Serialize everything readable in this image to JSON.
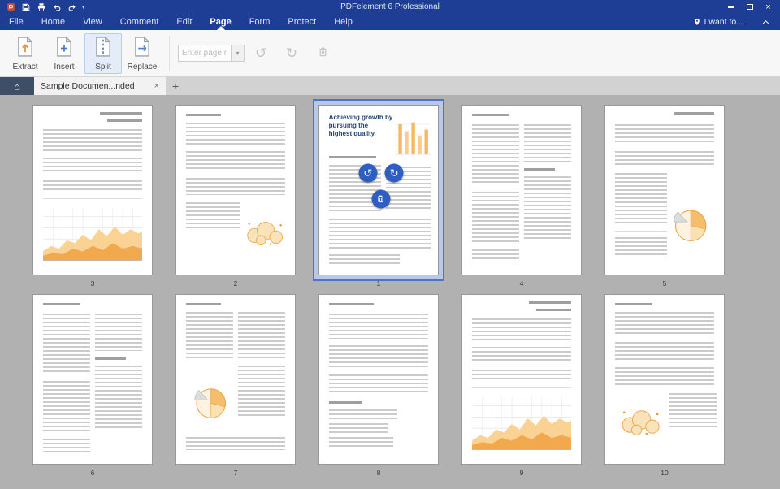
{
  "window": {
    "title": "PDFelement 6 Professional"
  },
  "menu": {
    "tabs": [
      "File",
      "Home",
      "View",
      "Comment",
      "Edit",
      "Page",
      "Form",
      "Protect",
      "Help"
    ],
    "active_tab": "Page",
    "i_want_to_label": "I want to..."
  },
  "ribbon": {
    "buttons": [
      {
        "label": "Extract"
      },
      {
        "label": "Insert"
      },
      {
        "label": "Split",
        "active": true
      },
      {
        "label": "Replace"
      }
    ],
    "page_range_placeholder": "Enter page r...",
    "tools": [
      "rotate-left",
      "rotate-right",
      "delete"
    ]
  },
  "tabbar": {
    "document_tab_label": "Sample Documen...nded"
  },
  "selected_page": {
    "number": "1",
    "title": "Achieving growth by pursuing the highest quality."
  },
  "thumbnails": [
    {
      "page": "3",
      "kind": "area-bottom",
      "selected": false
    },
    {
      "page": "2",
      "kind": "bubbles-right",
      "selected": false
    },
    {
      "page": "1",
      "kind": "selected-title",
      "selected": true
    },
    {
      "page": "4",
      "kind": "two-col",
      "selected": false
    },
    {
      "page": "5",
      "kind": "pie-right",
      "selected": false
    },
    {
      "page": "6",
      "kind": "two-col",
      "selected": false
    },
    {
      "page": "7",
      "kind": "pie-left",
      "selected": false
    },
    {
      "page": "8",
      "kind": "single-col",
      "selected": false
    },
    {
      "page": "9",
      "kind": "area-bottom",
      "selected": false
    },
    {
      "page": "10",
      "kind": "bubbles-left",
      "selected": false
    }
  ],
  "icons": {
    "rotate_left": "↺",
    "rotate_right": "↻",
    "home": "⌂",
    "close_tab": "×",
    "close_window": "×",
    "plus": "+",
    "dropdown": "▾",
    "caret_small": "▾"
  },
  "colors": {
    "titlebar_blue": "#1d3e94",
    "accent_blue": "#2e5ec4",
    "selection_border": "#4f74c5",
    "chart_orange": "#f2a94e",
    "canvas_gray": "#b1b1b1"
  }
}
